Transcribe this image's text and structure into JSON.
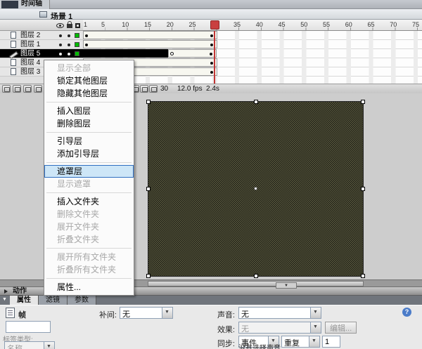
{
  "panel": {
    "timeline_tab": "时间轴",
    "scene_label": "场景 1"
  },
  "timeline": {
    "header_icons": [
      "eye-icon",
      "lock-icon",
      "outline-icon"
    ],
    "layers": [
      {
        "id": "layer-2",
        "name": "图层 2",
        "outline_color": "#00bb00",
        "selected": false
      },
      {
        "id": "layer-1",
        "name": "图层 1",
        "outline_color": "#00bb00",
        "selected": false
      },
      {
        "id": "layer-5",
        "name": "图层 5",
        "outline_color": "#00bb00",
        "selected": true
      },
      {
        "id": "layer-4",
        "name": "图层 4",
        "outline_color": "#2233ee",
        "selected": false
      },
      {
        "id": "layer-3",
        "name": "图层 3",
        "outline_color": "#00bb00",
        "selected": false
      }
    ],
    "ruler_frames": [
      1,
      5,
      10,
      15,
      20,
      25,
      30,
      35,
      40,
      45,
      50,
      55,
      60,
      65,
      70,
      75
    ],
    "playhead_frame": 30,
    "span_frames": 30,
    "selected_black_span_end": 19,
    "toolbar_icons": [
      "insert-layer-icon",
      "add-motion-guide-icon",
      "insert-layer-folder-icon",
      "delete-layer-icon"
    ],
    "onion_icons": [
      "center-frame-icon",
      "onion-skin-icon",
      "onion-skin-outlines-icon",
      "edit-multiple-frames-icon",
      "modify-onion-markers-icon"
    ],
    "status": {
      "current_frame": "30",
      "frame_rate": "12.0 fps",
      "elapsed_time": "2.4s"
    }
  },
  "context_menu": {
    "highlight_color": "#cde6f7",
    "items": [
      {
        "id": "show-all",
        "label": "显示全部",
        "enabled": false
      },
      {
        "id": "lock-others",
        "label": "锁定其他图层",
        "enabled": true
      },
      {
        "id": "hide-others",
        "label": "隐藏其他图层",
        "enabled": true
      },
      {
        "separator": true
      },
      {
        "id": "insert-layer",
        "label": "插入图层",
        "enabled": true
      },
      {
        "id": "delete-layer",
        "label": "删除图层",
        "enabled": true
      },
      {
        "separator": true
      },
      {
        "id": "guide",
        "label": "引导层",
        "enabled": true
      },
      {
        "id": "add-guide-layer",
        "label": "添加引导层",
        "enabled": true
      },
      {
        "separator": true
      },
      {
        "id": "mask",
        "label": "遮罩层",
        "enabled": true,
        "highlighted": true
      },
      {
        "id": "show-masking",
        "label": "显示遮罩",
        "enabled": false
      },
      {
        "separator": true
      },
      {
        "id": "insert-folder",
        "label": "插入文件夹",
        "enabled": true
      },
      {
        "id": "delete-folder",
        "label": "删除文件夹",
        "enabled": false
      },
      {
        "id": "expand-folder",
        "label": "展开文件夹",
        "enabled": false
      },
      {
        "id": "collapse-folder",
        "label": "折叠文件夹",
        "enabled": false
      },
      {
        "separator": true
      },
      {
        "id": "expand-all-folders",
        "label": "展开所有文件夹",
        "enabled": false
      },
      {
        "id": "collapse-all-folders",
        "label": "折叠所有文件夹",
        "enabled": false
      },
      {
        "separator": true
      },
      {
        "id": "properties",
        "label": "属性...",
        "enabled": true
      }
    ]
  },
  "actions_panel": {
    "label": "动作"
  },
  "properties_panel": {
    "tabs": [
      {
        "id": "properties",
        "label": "属性",
        "active": true
      },
      {
        "id": "filters",
        "label": "滤镜",
        "active": false
      },
      {
        "id": "parameters",
        "label": "参数",
        "active": false
      }
    ],
    "frame_caption": "帧",
    "frame_label_value": "",
    "label_type_caption": "标签类型:",
    "label_type_value": "名称",
    "tween_caption": "补间:",
    "tween_value": "无",
    "sound_caption": "声音:",
    "sound_value": "无",
    "effect_caption": "效果:",
    "effect_value": "无",
    "edit_button_label": "编辑...",
    "sync_caption": "同步:",
    "sync_event_value": "事件",
    "sync_repeat_value": "重复",
    "sync_loop_count": "1",
    "no_sound_message": "没有选择声音"
  }
}
